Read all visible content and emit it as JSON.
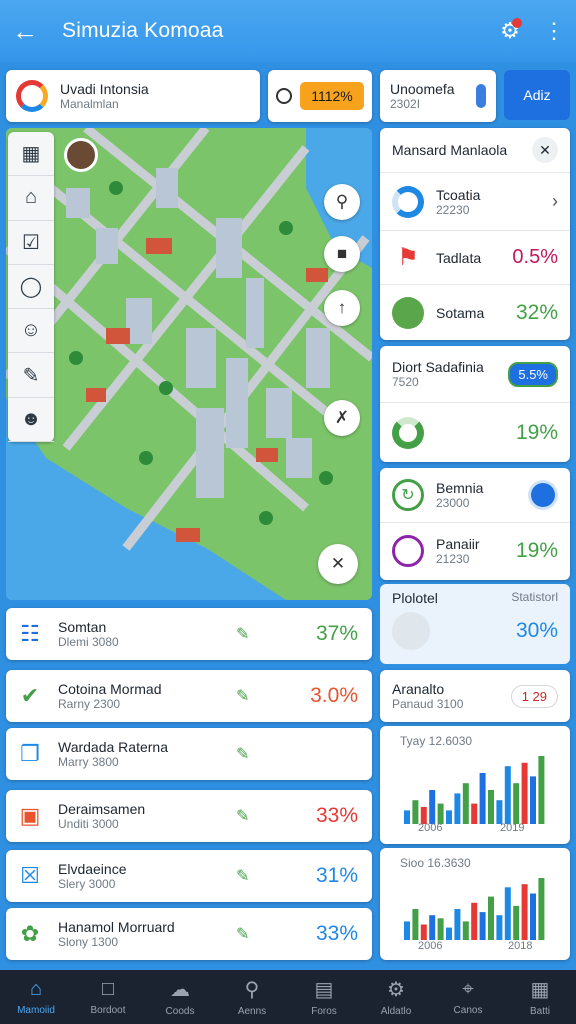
{
  "app": {
    "title": "Simuzia Komoaa"
  },
  "header": {
    "card1": {
      "title": "Uvadi Intonsia",
      "subtitle": "Manalmlan"
    },
    "pill": {
      "value": "1112%"
    },
    "card2": {
      "title": "Unoomefa",
      "subtitle": "2302I"
    },
    "button": "Adiz"
  },
  "panel": {
    "title": "Mansard Manlaola",
    "items": [
      {
        "name": "Tcoatia",
        "sub": "22230",
        "value": "",
        "color": "#1e88e5"
      },
      {
        "name": "Tadlata",
        "sub": "",
        "value": "0.5%",
        "color": "#c2185b"
      },
      {
        "name": "Sotama",
        "sub": "",
        "value": "32%",
        "color": "#43a047"
      }
    ]
  },
  "panel2": {
    "title": "Diort Sadafinia",
    "sub": "7520",
    "badge": "5.5%",
    "value": "19%"
  },
  "panel3": {
    "items": [
      {
        "name": "Bemnia",
        "sub": "23000",
        "value": ""
      },
      {
        "name": "Panaiir",
        "sub": "21230",
        "value": "19%"
      }
    ]
  },
  "stats": {
    "left": "Plolotel",
    "right": "Statistorl",
    "value": "30%"
  },
  "analysis": {
    "title": "Aranalto",
    "sub": "Panaud 3100",
    "badge": "1 29"
  },
  "chart1": {
    "label": "Tyay 12.6030",
    "xlabels": [
      "2006",
      "2019"
    ]
  },
  "chart2": {
    "label": "Sioo 16.3630",
    "xlabels": [
      "2006",
      "2018"
    ]
  },
  "list": [
    {
      "title": "Somtan",
      "sub": "Dlemi 3080",
      "value": "37%",
      "value_color": "#43a047",
      "icon": "document-icon",
      "icon_color": "#1e6fe0"
    },
    {
      "title": "Cotoina Mormad",
      "sub": "Rarny 2300",
      "value": "3.0%",
      "value_color": "#e8542e",
      "icon": "check-icon",
      "icon_color": "#43a047"
    },
    {
      "title": "Wardada Raterna",
      "sub": "Marry 3800",
      "value": "",
      "value_color": "#1e88e5",
      "icon": "clipboard-icon",
      "icon_color": "#1e88e5"
    },
    {
      "title": "Deraimsamen",
      "sub": "Unditi 3000",
      "value": "33%",
      "value_color": "#e53935",
      "icon": "folder-icon",
      "icon_color": "#e8542e"
    },
    {
      "title": "Elvdaeince",
      "sub": "Slery 3000",
      "value": "31%",
      "value_color": "#1e88e5",
      "icon": "box-icon",
      "icon_color": "#1e88e5"
    },
    {
      "title": "Hanamol Morruard",
      "sub": "Slony 1300",
      "value": "33%",
      "value_color": "#1e88e5",
      "icon": "leaf-icon",
      "icon_color": "#43a047"
    }
  ],
  "nav": [
    {
      "label": "Mamoiid",
      "icon": "home-icon",
      "active": true
    },
    {
      "label": "Bordoot",
      "icon": "monitor-icon",
      "active": false
    },
    {
      "label": "Coods",
      "icon": "cloud-icon",
      "active": false
    },
    {
      "label": "Aenns",
      "icon": "search-icon",
      "active": false
    },
    {
      "label": "Foros",
      "icon": "calendar-icon",
      "active": false
    },
    {
      "label": "Aldatlo",
      "icon": "settings-icon",
      "active": false
    },
    {
      "label": "Canos",
      "icon": "location-icon",
      "active": false
    },
    {
      "label": "Batti",
      "icon": "archive-icon",
      "active": false
    }
  ]
}
